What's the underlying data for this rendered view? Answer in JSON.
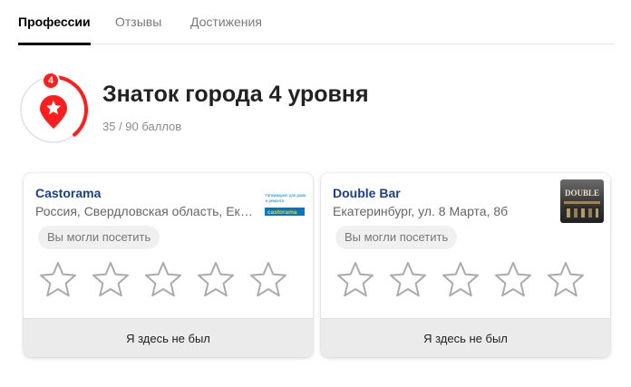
{
  "tabs": [
    {
      "label": "Профессии",
      "active": true
    },
    {
      "label": "Отзывы",
      "active": false
    },
    {
      "label": "Достижения",
      "active": false
    }
  ],
  "level": {
    "number": "4",
    "title": "Знаток города 4 уровня",
    "score": "35 / 90 баллов",
    "progress": 0.389,
    "icon": "star-icon",
    "accent_color": "#ff1e1e"
  },
  "places": [
    {
      "name": "Castorama",
      "address": "Россия, Свердловская область, Екатеринбург",
      "visit_badge": "Вы могли посетить",
      "rating": 0,
      "max_rating": 5,
      "footer": "Я здесь не был",
      "logo": "castorama-logo",
      "logo_text": "castorama",
      "logo_tagline": "Гипермаркет для дома и ремонта"
    },
    {
      "name": "Double Bar",
      "address": "Екатеринбург, ул. 8 Марта, 8б",
      "visit_badge": "Вы могли посетить",
      "rating": 0,
      "max_rating": 5,
      "footer": "Я здесь не был",
      "logo": "double-bar-photo",
      "logo_text": "DOUBLE"
    }
  ],
  "colors": {
    "link": "#1a3e8c",
    "accent": "#ff1e1e",
    "castorama_blue": "#0078c8"
  }
}
